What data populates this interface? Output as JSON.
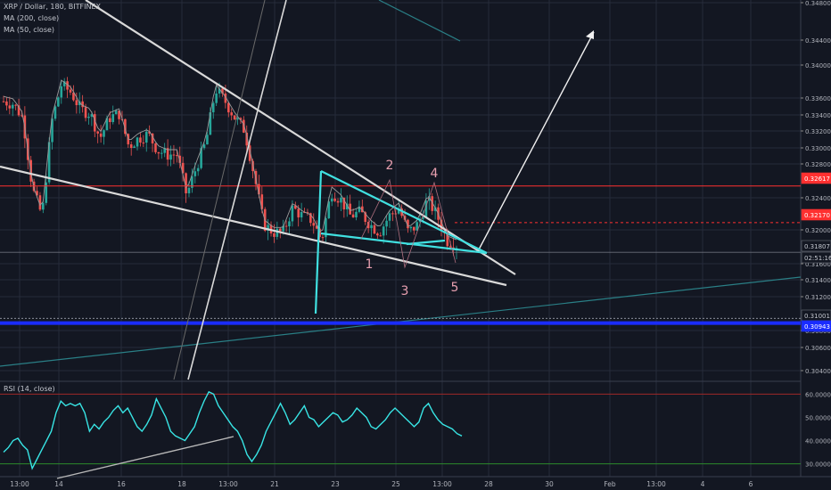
{
  "legend": {
    "symbol": "XRP / Dollar, 180, BITFINEX",
    "ma200": "MA (200, close)",
    "ma50": "MA (50, close)",
    "rsi": "RSI (14, close)"
  },
  "colors": {
    "background": "#131722",
    "grid": "#262b3a",
    "bull": "#26a69a",
    "bear": "#ef5350",
    "trendline": "#d9d9d9",
    "pattern": "#40e0e0",
    "support_blue": "#1a2cff",
    "red_level": "#ff3030",
    "rsi_line": "#38e5e5",
    "wave_label": "#e8a0b0",
    "ma200": "#2a7f86",
    "ma50": "#9a9a9a"
  },
  "price_axis": {
    "ticks": [
      "0.34800",
      "0.34400",
      "0.34000",
      "0.33600",
      "0.33400",
      "0.33200",
      "0.33000",
      "0.32800",
      "0.32400",
      "0.32000",
      "0.31600",
      "0.31400",
      "0.31200",
      "0.30800",
      "0.30600",
      "0.30400"
    ],
    "tags": [
      {
        "label": "0.32617",
        "color": "#ff3030",
        "text": "#ffffff"
      },
      {
        "label": "0.32170",
        "color": "#ff3030",
        "text": "#ffffff"
      },
      {
        "label": "0.31807",
        "color": "#131722",
        "text": "#c3c6ce"
      },
      {
        "label": "02:51:16",
        "color": "#131722",
        "text": "#c3c6ce"
      },
      {
        "label": "0.31001",
        "color": "#131722",
        "text": "#c3c6ce"
      },
      {
        "label": "0.30943",
        "color": "#1a2cff",
        "text": "#ffffff"
      }
    ]
  },
  "time_axis": {
    "ticks": [
      "13:00",
      "14",
      "16",
      "18",
      "13:00",
      "21",
      "23",
      "25",
      "13:00",
      "28",
      "30",
      "Feb",
      "13:00",
      "4",
      "6"
    ]
  },
  "rsi_axis": {
    "ticks": [
      "60.0000",
      "50.0000",
      "40.0000",
      "30.0000"
    ]
  },
  "wave_labels": [
    "1",
    "2",
    "3",
    "4",
    "5"
  ],
  "chart_data": {
    "type": "candlestick",
    "title": "XRP / Dollar, 180, BITFINEX",
    "x": [
      "13:00",
      "14",
      "16",
      "18",
      "13:00",
      "21",
      "23",
      "25",
      "13:00",
      "28",
      "30",
      "Feb",
      "13:00",
      "4",
      "6"
    ],
    "ylim": [
      0.303,
      0.349
    ],
    "series": [
      {
        "name": "XRP / Dollar",
        "type": "candlestick",
        "approx_path_close": [
          0.3365,
          0.3362,
          0.3345,
          0.3258,
          0.3225,
          0.334,
          0.3385,
          0.3376,
          0.3355,
          0.335,
          0.332,
          0.3345,
          0.335,
          0.331,
          0.332,
          0.3325,
          0.3305,
          0.33,
          0.33,
          0.325,
          0.3285,
          0.3315,
          0.338,
          0.3365,
          0.3345,
          0.333,
          0.3275,
          0.3215,
          0.3205,
          0.3205,
          0.3235,
          0.3225,
          0.322,
          0.3195,
          0.3255,
          0.3245,
          0.3225,
          0.323,
          0.3215,
          0.3205,
          0.3225,
          0.3235,
          0.3205,
          0.3215,
          0.3245,
          0.3225,
          0.3195,
          0.319
        ]
      },
      {
        "name": "MA (200, close)",
        "type": "line"
      },
      {
        "name": "MA (50, close)",
        "type": "line"
      }
    ],
    "price_levels": [
      0.32617,
      0.3217,
      0.31807,
      0.31001,
      0.30943
    ],
    "rsi": {
      "name": "RSI (14, close)",
      "ylim": [
        26,
        64
      ],
      "bands": [
        60,
        30
      ],
      "values": [
        35,
        37,
        40,
        41,
        38,
        36,
        28,
        32,
        36,
        40,
        44,
        52,
        57,
        55,
        56,
        55,
        56,
        52,
        44,
        47,
        45,
        48,
        50,
        53,
        55,
        52,
        54,
        50,
        46,
        44,
        47,
        51,
        58,
        54,
        50,
        44,
        42,
        41,
        40,
        43,
        46,
        52,
        57,
        61,
        60,
        55,
        52,
        49,
        46,
        44,
        40,
        34,
        31,
        34,
        38,
        44,
        48,
        52,
        56,
        52,
        47,
        49,
        52,
        55,
        50,
        49,
        46,
        48,
        50,
        52,
        51,
        48,
        49,
        51,
        54,
        52,
        50,
        46,
        45,
        47,
        49,
        52,
        54,
        52,
        50,
        48,
        46,
        48,
        54,
        56,
        52,
        49,
        47,
        46,
        45,
        43,
        42
      ]
    },
    "grid": true,
    "legend": "top-left"
  }
}
